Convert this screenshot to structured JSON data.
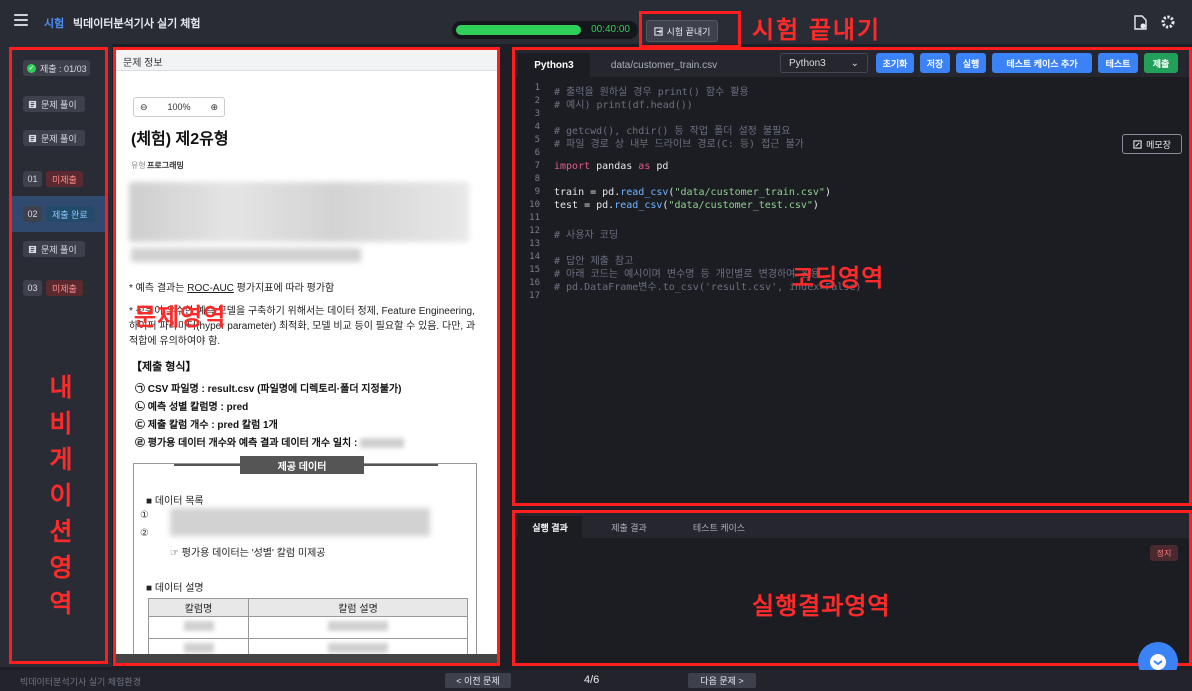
{
  "header": {
    "category": "시험",
    "title": "빅데이터분석기사 실기 체험",
    "timer": "00:40:00",
    "timer_progress": 0.7,
    "end_exam_button": "시험 끝내기",
    "end_exam_annotation": "시험 끝내기"
  },
  "nav": {
    "submit_count": "제출 : 01/03",
    "solve_label": "문제 풀이",
    "questions": [
      {
        "num": "01",
        "status": "미제출"
      },
      {
        "num": "02",
        "status": "제출 완료"
      },
      {
        "num": "03",
        "status": "미제출"
      }
    ],
    "annotation": [
      "내",
      "비",
      "게",
      "이",
      "션",
      "영",
      "역"
    ]
  },
  "problem": {
    "header": "문제 정보",
    "zoom": "100%",
    "title": "(체험) 제2유형",
    "type_label": "유형",
    "type_value": "프로그래밍",
    "bullet1_prefix": "* 예측 결과는 ",
    "bullet1_link": "ROC-AUC",
    "bullet1_suffix": " 평가지표에 따라 평가함",
    "bullet2": "* 성능이 우수한 예측 모델을 구축하기 위해서는 데이터 정제, Feature Engineering, 하이퍼 파라미터(hyper parameter) 최적화, 모델 비교 등이 필요할 수 있음. 다만, 과적합에 유의하여야 함.",
    "submit_format_title": "【제출 형식】",
    "submit_lines": [
      "㉠ CSV 파일명 : result.csv (파일명에 디렉토리·폴더 지정불가)",
      "㉡ 예측 성별 칼럼명 : pred",
      "㉢ 제출 칼럼 개수 : pred 칼럼 1개",
      "㉣ 평가용 데이터 개수와 예측 결과 데이터 개수 일치 :"
    ],
    "annotation": "문제영역",
    "data_header": "제공 데이터",
    "data_list_title": "■ 데이터 목록",
    "data_list_marks": [
      "①",
      "②"
    ],
    "data_note": "☞ 평가용 데이터는 '성별' 칼럼 미제공",
    "data_desc_title": "■ 데이터 설명",
    "table_headers": [
      "칼럼명",
      "칼럼 설명"
    ]
  },
  "editor": {
    "tab_active": "Python3",
    "tab_file": "data/customer_train.csv",
    "language": "Python3",
    "buttons": [
      "초기화",
      "저장",
      "실행",
      "테스트 케이스 추가",
      "테스트",
      "제출"
    ],
    "memo": "메모장",
    "line_numbers": [
      "1",
      "2",
      "3",
      "4",
      "5",
      "6",
      "7",
      "8",
      "9",
      "10",
      "11",
      "12",
      "13",
      "14",
      "15",
      "16",
      "17"
    ],
    "annotation": "코딩영역"
  },
  "result": {
    "tabs": [
      "실행 결과",
      "제출 결과",
      "테스트 케이스"
    ],
    "stop": "정지",
    "annotation": "실행결과영역"
  },
  "footer": {
    "env": "빅데이터분석기사 실기 체험환경",
    "prev": "< 이전 문제",
    "page": "4/6",
    "next": "다음 문제 >"
  },
  "colors": {
    "accent_blue": "#3b82f6",
    "accent_green": "#22a05a",
    "timer_green": "#2fcf5a",
    "annotation_red": "#ff2a2a"
  }
}
